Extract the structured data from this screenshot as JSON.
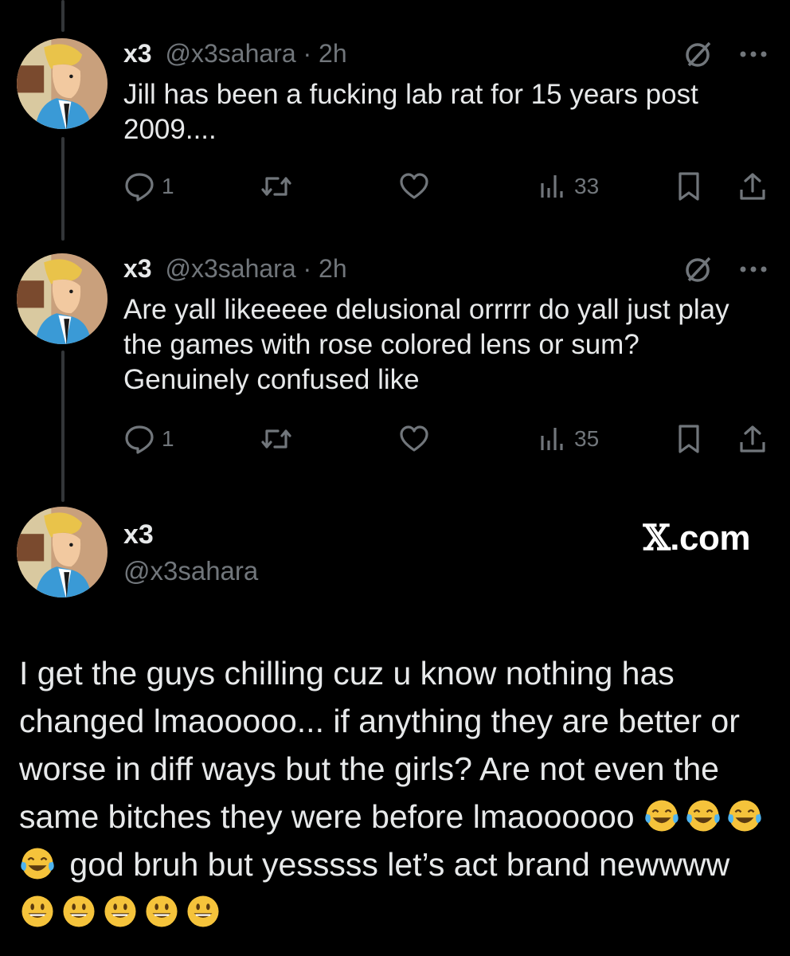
{
  "tweets": [
    {
      "name": "x3",
      "handle": "@x3sahara",
      "time": "· 2h",
      "text": "Jill has been a fucking lab rat for 15 years post 2009....",
      "replies": "1",
      "views": "33"
    },
    {
      "name": "x3",
      "handle": "@x3sahara",
      "time": "· 2h",
      "text": "Are yall likeeeee delusional orrrrr do yall just play the games with rose colored lens or sum? Genuinely confused like",
      "replies": "1",
      "views": "35"
    }
  ],
  "card": {
    "name": "x3",
    "handle": "@x3sahara",
    "brand_mark": "𝕏",
    "brand_text": ".com",
    "text_part1": "I get the guys chilling cuz u know nothing has changed lmaooooo... if anything they are better or worse in diff ways but the girls? Are not even the same bitches they were before lmaoooooo",
    "text_part2": "god bruh but yesssss let’s act brand newwww",
    "emoji_group1": "face-with-tears-of-joy-emoji ×4",
    "emoji_group2": "grinning-face-emoji ×5"
  },
  "colors": {
    "background": "#000000",
    "text": "#e7e9ea",
    "muted": "#71767b",
    "thread_line": "#333639"
  },
  "icons": [
    "reply-icon",
    "retweet-icon",
    "like-icon",
    "views-icon",
    "bookmark-icon",
    "share-icon",
    "grok-icon",
    "more-icon"
  ]
}
